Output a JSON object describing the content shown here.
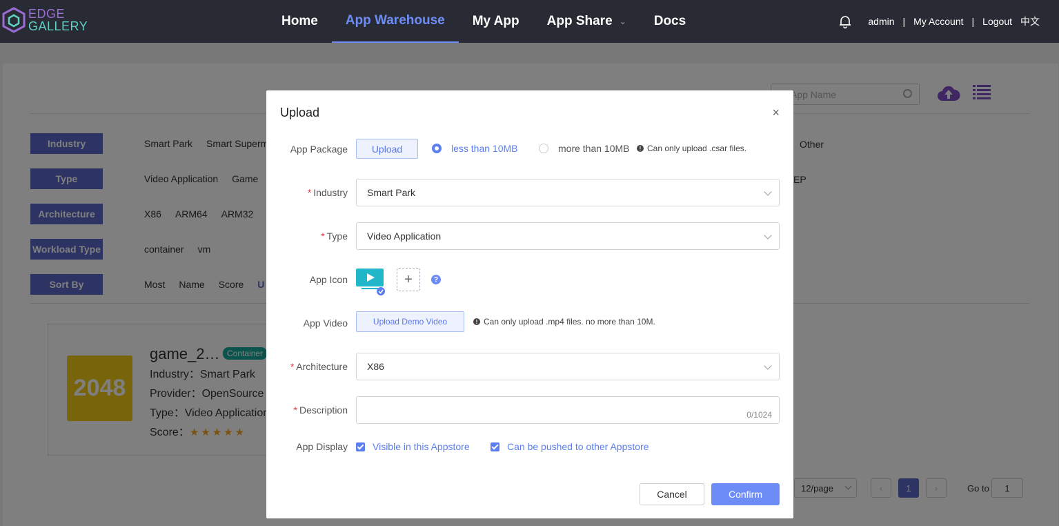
{
  "brand": {
    "line1": "EDGE",
    "line2": "GALLERY"
  },
  "nav": {
    "items": [
      "Home",
      "App Warehouse",
      "My App",
      "App Share",
      "Docs"
    ],
    "active": "App Warehouse",
    "user": "admin",
    "sep": "|",
    "my_account": "My Account",
    "logout": "Logout",
    "lang": "中文"
  },
  "search": {
    "placeholder": "App Name"
  },
  "filters": {
    "industry": {
      "label": "Industry",
      "options": [
        "Smart Park",
        "Smart Superm"
      ],
      "trailing": "Other"
    },
    "type": {
      "label": "Type",
      "options": [
        "Video Application",
        "Game"
      ],
      "trailing": "EP"
    },
    "architecture": {
      "label": "Architecture",
      "options": [
        "X86",
        "ARM64",
        "ARM32"
      ]
    },
    "workload": {
      "label": "Workload Type",
      "options": [
        "container",
        "vm"
      ]
    },
    "sort": {
      "label": "Sort By",
      "options": [
        "Most",
        "Name",
        "Score",
        "U"
      ]
    }
  },
  "card": {
    "image_text": "2048",
    "title": "game_2…",
    "badge": "Container",
    "industry": "Industry：Smart Park",
    "provider": "Provider：OpenSource",
    "type": "Type：Video Application",
    "score_label": "Score：",
    "stars": "★★★★★"
  },
  "pagination": {
    "page_size": "12/page",
    "current": "1",
    "goto_label": "Go to",
    "goto_value": "1"
  },
  "modal": {
    "title": "Upload",
    "close": "×",
    "app_package": {
      "label": "App Package",
      "upload_button": "Upload",
      "opt_small": "less than 10MB",
      "opt_large": "more than 10MB",
      "selected": "less than 10MB",
      "hint": "Can only upload .csar files."
    },
    "industry": {
      "label": "Industry",
      "value": "Smart Park"
    },
    "type": {
      "label": "Type",
      "value": "Video Application"
    },
    "app_icon": {
      "label": "App Icon",
      "add": "+",
      "help": "?"
    },
    "app_video": {
      "label": "App Video",
      "button": "Upload Demo Video",
      "hint": "Can only upload .mp4 files. no more than 10M."
    },
    "architecture": {
      "label": "Architecture",
      "value": "X86"
    },
    "description": {
      "label": "Description",
      "value": "",
      "counter": "0/1024"
    },
    "app_display": {
      "label": "App Display",
      "visible": "Visible in this Appstore",
      "pushable": "Can be pushed to other Appstore",
      "visible_checked": true,
      "pushable_checked": true
    },
    "required_mark": "*",
    "cancel": "Cancel",
    "confirm": "Confirm"
  },
  "colors": {
    "accent": "#6e8cf5",
    "nav_bg": "#282b33",
    "filter_label_bg": "#5b67c7",
    "badge": "#17a89a",
    "required": "#e4393c"
  }
}
